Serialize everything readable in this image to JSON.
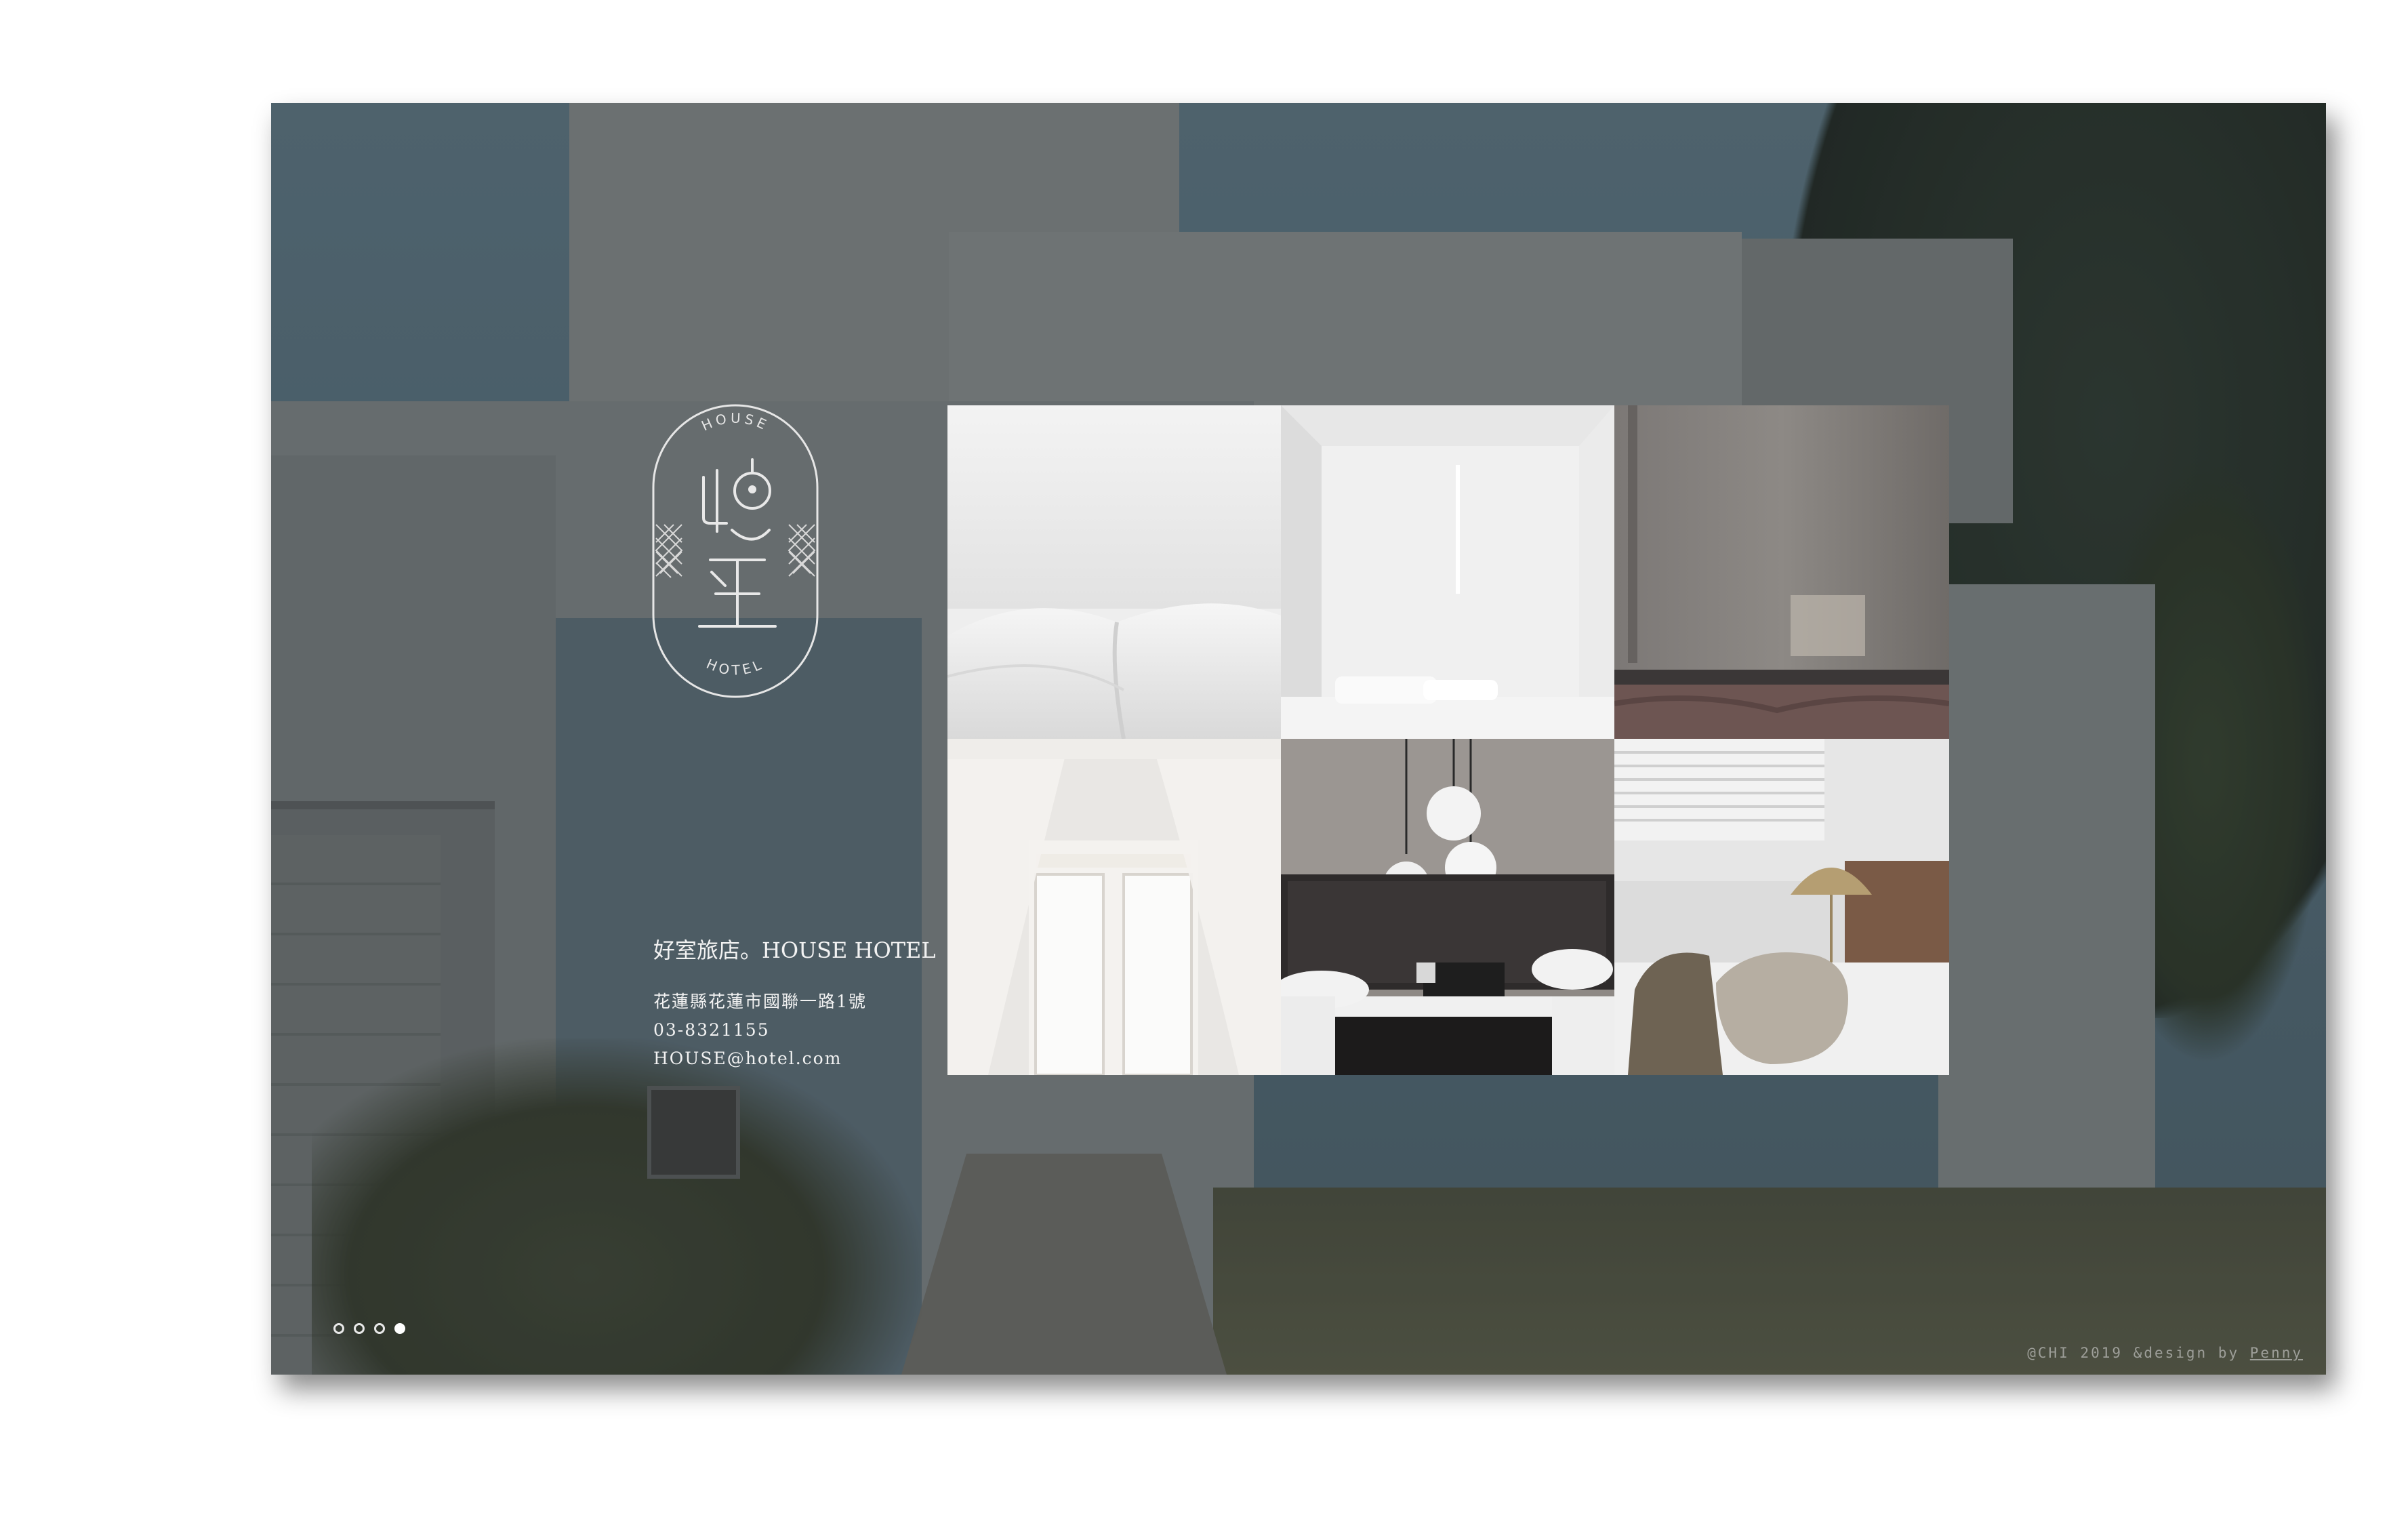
{
  "brand": {
    "logo_top_text": "HOUSE",
    "logo_bottom_text": "HOTEL",
    "name": "好室旅店。HOUSE HOTEL"
  },
  "contact": {
    "address": "花蓮縣花蓮市國聯一路1號",
    "phone": "03-8321155",
    "email": "HOUSE@hotel.com"
  },
  "gallery": {
    "photos": [
      {
        "name": "white-bed-sheets-photo"
      },
      {
        "name": "white-room-light-strip-photo"
      },
      {
        "name": "concrete-wall-bed-photo"
      },
      {
        "name": "white-curtain-door-photo"
      },
      {
        "name": "pendant-lamps-bedroom-photo"
      },
      {
        "name": "pillows-brass-lamp-photo"
      }
    ]
  },
  "carousel": {
    "slide_count": 4,
    "active_index": 3
  },
  "footer": {
    "credit_prefix": "@CHI 2019 &design by ",
    "credit_author": "Penny"
  },
  "colors": {
    "text": "#f2f2f2",
    "overlay": "#282a2c",
    "dot_active": "#ffffff"
  }
}
